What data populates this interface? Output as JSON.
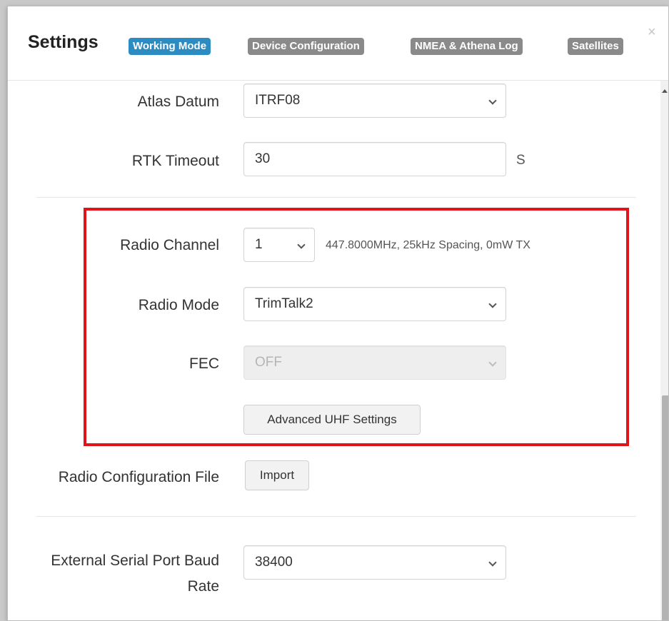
{
  "dialog": {
    "title": "Settings",
    "close_glyph": "×",
    "tabs": [
      {
        "label": "Working Mode",
        "active": true
      },
      {
        "label": "Device Configuration",
        "active": false
      },
      {
        "label": "NMEA & Athena Log",
        "active": false
      },
      {
        "label": "Satellites",
        "active": false
      }
    ]
  },
  "form": {
    "atlas_datum": {
      "label": "Atlas Datum",
      "value": "ITRF08"
    },
    "rtk_timeout": {
      "label": "RTK Timeout",
      "value": "30",
      "unit": "S"
    },
    "radio_channel": {
      "label": "Radio Channel",
      "value": "1",
      "info": "447.8000MHz, 25kHz Spacing, 0mW TX"
    },
    "radio_mode": {
      "label": "Radio Mode",
      "value": "TrimTalk2"
    },
    "fec": {
      "label": "FEC",
      "value": "OFF",
      "disabled": true
    },
    "advanced_uhf": {
      "label": "Advanced UHF Settings"
    },
    "radio_config_file": {
      "label": "Radio Configuration File",
      "button": "Import"
    },
    "baud_rate": {
      "label_line1": "External Serial Port Baud",
      "label_line2": "Rate",
      "value": "38400"
    }
  },
  "colors": {
    "active_tab": "#2c8bc1",
    "inactive_tab": "#8a8a8a",
    "highlight_border": "#e3131b"
  },
  "icons": [
    "close-icon",
    "chevron-down-icon",
    "scroll-up-arrow-icon"
  ]
}
